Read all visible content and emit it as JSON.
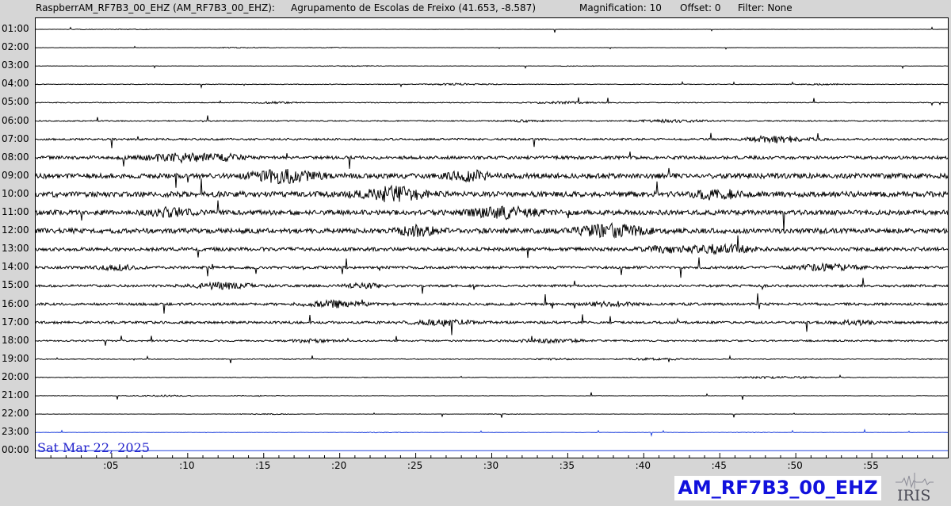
{
  "header": {
    "station": "RaspberrAM_RF7B3_00_EHZ (AM_RF7B3_00_EHZ):",
    "location": "Agrupamento de Escolas de Freixo (41.653, -8.587)",
    "magnification": "Magnification: 10",
    "offset": "Offset: 0",
    "filter": "Filter: None"
  },
  "rows": [
    "01:00",
    "02:00",
    "03:00",
    "04:00",
    "05:00",
    "06:00",
    "07:00",
    "08:00",
    "09:00",
    "10:00",
    "11:00",
    "12:00",
    "13:00",
    "14:00",
    "15:00",
    "16:00",
    "17:00",
    "18:00",
    "19:00",
    "20:00",
    "21:00",
    "22:00",
    "23:00",
    "00:00"
  ],
  "row_activity": [
    0.15,
    0.2,
    0.2,
    0.4,
    0.5,
    0.7,
    1.2,
    2.0,
    3.2,
    3.4,
    3.0,
    3.1,
    2.2,
    1.6,
    1.5,
    1.6,
    1.5,
    1.0,
    0.5,
    0.4,
    0.3,
    0.2,
    0.15,
    0.0
  ],
  "x_ticks": [
    ":05",
    ":10",
    ":15",
    ":20",
    ":25",
    ":30",
    ":35",
    ":40",
    ":45",
    ":50",
    ":55"
  ],
  "date": "Sat Mar 22, 2025",
  "channel": "AM_RF7B3_00_EHZ",
  "logo_text": "IRIS",
  "colors": {
    "trace": "#000000",
    "partial": "#2244dd",
    "background": "#d6d6d6",
    "plot": "#ffffff"
  }
}
